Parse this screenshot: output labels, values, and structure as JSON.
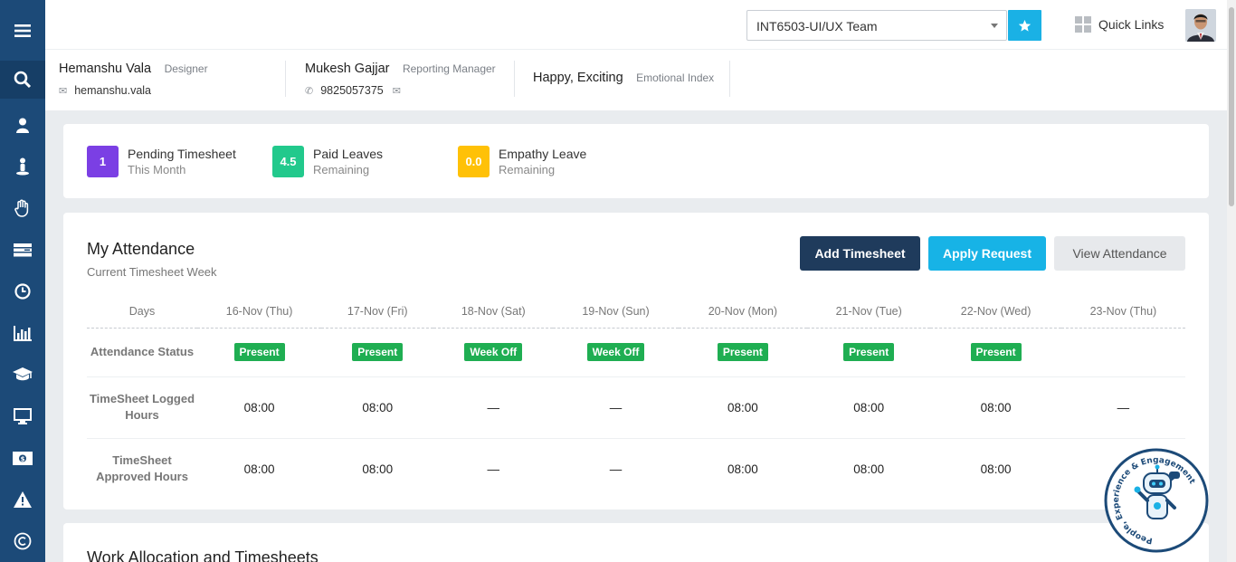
{
  "topbar": {
    "team_select": "INT6503-UI/UX Team",
    "quick_links": "Quick Links"
  },
  "profile": {
    "user": {
      "name": "Hemanshu Vala",
      "role": "Designer",
      "email": "hemanshu.vala"
    },
    "manager": {
      "name": "Mukesh Gajjar",
      "role": "Reporting Manager",
      "phone": "9825057375"
    },
    "emotion": {
      "value": "Happy, Exciting",
      "label": "Emotional Index"
    }
  },
  "stats": [
    {
      "value": "1",
      "title": "Pending Timesheet",
      "sub": "This Month",
      "color": "#7b3fe4"
    },
    {
      "value": "4.5",
      "title": "Paid Leaves",
      "sub": "Remaining",
      "color": "#22c98c"
    },
    {
      "value": "0.0",
      "title": "Empathy Leave",
      "sub": "Remaining",
      "color": "#ffc107"
    }
  ],
  "attendance": {
    "title": "My Attendance",
    "subtitle": "Current Timesheet Week",
    "buttons": {
      "add": "Add Timesheet",
      "apply": "Apply Request",
      "view": "View Attendance"
    },
    "days_label": "Days",
    "days": [
      "16-Nov (Thu)",
      "17-Nov (Fri)",
      "18-Nov (Sat)",
      "19-Nov (Sun)",
      "20-Nov (Mon)",
      "21-Nov (Tue)",
      "22-Nov (Wed)",
      "23-Nov (Thu)"
    ],
    "rows": {
      "status": {
        "label": "Attendance Status",
        "values": [
          "Present",
          "Present",
          "Week Off",
          "Week Off",
          "Present",
          "Present",
          "Present",
          ""
        ]
      },
      "logged": {
        "label": "TimeSheet Logged Hours",
        "values": [
          "08:00",
          "08:00",
          "—",
          "—",
          "08:00",
          "08:00",
          "08:00",
          "—"
        ]
      },
      "approved": {
        "label": "TimeSheet Approved Hours",
        "values": [
          "08:00",
          "08:00",
          "—",
          "—",
          "08:00",
          "08:00",
          "08:00",
          ""
        ]
      }
    }
  },
  "work": {
    "title": "Work Allocation and Timesheets"
  },
  "badge": {
    "text": "People, Experience & Engagement"
  },
  "colors": {
    "sidebar": "#1c4a78",
    "accent": "#17b3e6",
    "dark_button": "#1f3b5c",
    "present": "#1fae52"
  },
  "sidebar_icons": [
    "menu-icon",
    "search-icon",
    "user-icon",
    "person-icon",
    "hand-icon",
    "card-icon",
    "clock-icon",
    "chart-icon",
    "graduation-cap-icon",
    "monitor-icon",
    "money-icon",
    "warning-icon",
    "copyright-icon"
  ]
}
